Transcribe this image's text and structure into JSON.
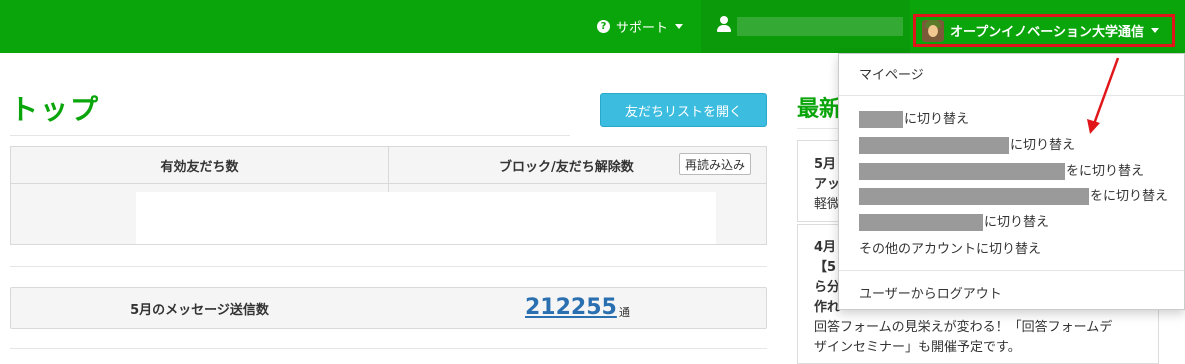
{
  "navbar": {
    "support_label": "サポート",
    "account_name": "オープンイノベーション大学通信",
    "brand_color": "#0aa50a"
  },
  "page": {
    "title": "トップ",
    "friends_list_button": "友だちリストを開く"
  },
  "stats": {
    "valid_friends_header": "有効友だち数",
    "blocked_header": "ブロック/友だち解除数",
    "reload_button": "再読み込み"
  },
  "messages": {
    "label": "5月のメッセージ送信数",
    "count": "212255",
    "unit": "通"
  },
  "news": {
    "title": "最新",
    "item1": {
      "line1": "5月",
      "line2": "アッ",
      "line3": "軽微"
    },
    "item2": {
      "line1": "4月",
      "line2": "【5",
      "line3": "ら分",
      "line4": "作れ",
      "line5": "回答フォームの見栄えが変わる！「回答フォームデ",
      "line6": "ザインセミナー」も開催予定です。"
    }
  },
  "dropdown": {
    "my_page": "マイページ",
    "switch_suffix": "に切り替え",
    "switch_suffix_partial": "をに切り替え",
    "other_accounts": "その他のアカウントに切り替え",
    "logout": "ユーザーからログアウト"
  },
  "annotation": {
    "arrow_color": "#e0161b"
  }
}
